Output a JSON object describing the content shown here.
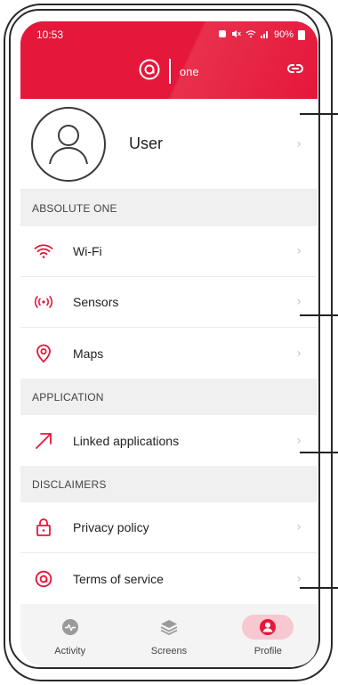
{
  "status_bar": {
    "time": "10:53",
    "battery": "90%"
  },
  "header": {
    "brand_text": "one",
    "colors": {
      "accent": "#e5173a"
    }
  },
  "user": {
    "name": "User"
  },
  "sections": [
    {
      "title": "ABSOLUTE ONE",
      "items": [
        {
          "label": "Wi-Fi",
          "icon": "wifi-icon"
        },
        {
          "label": "Sensors",
          "icon": "sensors-icon"
        },
        {
          "label": "Maps",
          "icon": "map-pin-icon"
        }
      ]
    },
    {
      "title": "APPLICATION",
      "items": [
        {
          "label": "Linked applications",
          "icon": "arrow-up-right-icon"
        }
      ]
    },
    {
      "title": "DISCLAIMERS",
      "items": [
        {
          "label": "Privacy policy",
          "icon": "lock-icon"
        },
        {
          "label": "Terms of service",
          "icon": "brand-a-icon"
        }
      ]
    }
  ],
  "bottom_nav": [
    {
      "label": "Activity",
      "icon": "activity-icon",
      "active": false
    },
    {
      "label": "Screens",
      "icon": "layers-icon",
      "active": false
    },
    {
      "label": "Profile",
      "icon": "person-icon",
      "active": true
    }
  ]
}
